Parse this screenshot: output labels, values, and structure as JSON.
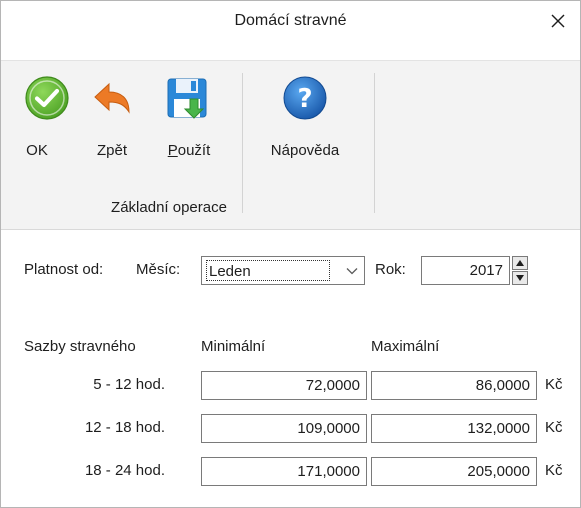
{
  "window": {
    "title": "Domácí stravné"
  },
  "ribbon": {
    "buttons": [
      {
        "label": "OK",
        "icon": "check-circle-icon",
        "color": "#5cb22e"
      },
      {
        "label": "Zpět",
        "icon": "undo-arrow-icon",
        "color": "#e87722"
      },
      {
        "label": "Použít",
        "icon": "save-floppy-icon",
        "color": "#2f8fd8"
      },
      {
        "label": "Nápověda",
        "icon": "help-question-icon",
        "color": "#1f6fc5"
      }
    ],
    "group_label": "Základní operace"
  },
  "validity": {
    "label": "Platnost od:",
    "month_label": "Měsíc:",
    "month_value": "Leden",
    "year_label": "Rok:",
    "year_value": "2017"
  },
  "rates": {
    "header_label": "Sazby stravného",
    "col_min": "Minimální",
    "col_max": "Maximální",
    "currency": "Kč",
    "rows": [
      {
        "label": "5 - 12 hod.",
        "min": "72,0000",
        "max": "86,0000"
      },
      {
        "label": "12 - 18 hod.",
        "min": "109,0000",
        "max": "132,0000"
      },
      {
        "label": "18 - 24 hod.",
        "min": "171,0000",
        "max": "205,0000"
      }
    ]
  }
}
